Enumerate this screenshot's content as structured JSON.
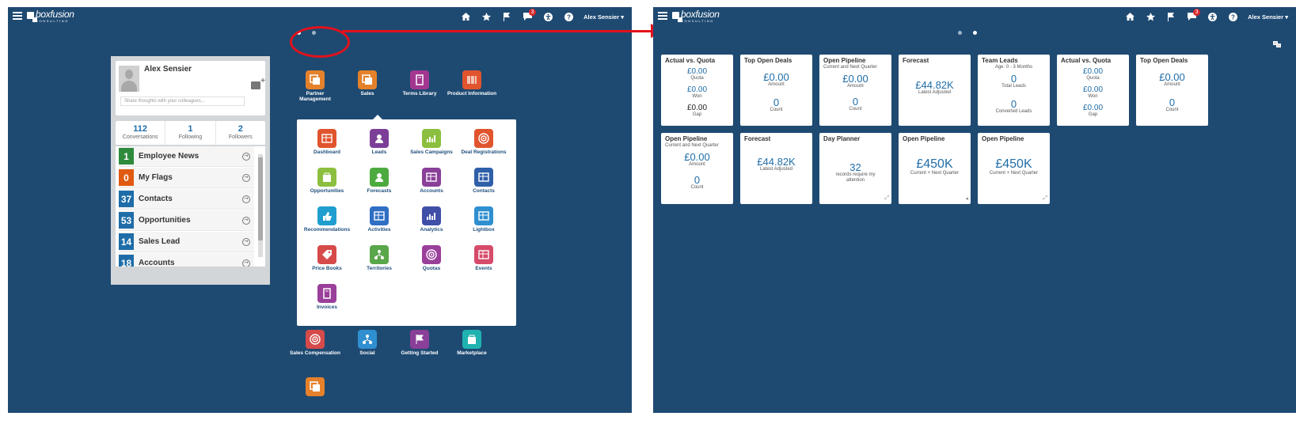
{
  "brand": {
    "name": "boxfusion",
    "sub": "CONSULTING"
  },
  "user": {
    "name": "Alex Sensier ▾"
  },
  "notifications": {
    "count": "3"
  },
  "icons": [
    "menu-icon",
    "home-icon",
    "star-icon",
    "flag-icon",
    "chat-icon",
    "accessibility-icon",
    "help-icon"
  ],
  "colors": {
    "background": "#1e4a72",
    "accent": "#1f6da8",
    "callout": "#e4111b"
  },
  "profile": {
    "name": "Alex Sensier",
    "share_placeholder": "Share thoughts with your colleagues...",
    "stats": [
      {
        "n": "112",
        "l": "Conversations"
      },
      {
        "n": "1",
        "l": "Following"
      },
      {
        "n": "2",
        "l": "Followers"
      }
    ],
    "items": [
      {
        "count": "1",
        "label": "Employee News",
        "color": "#2e8b3c"
      },
      {
        "count": "0",
        "label": "My Flags",
        "color": "#e05a12"
      },
      {
        "count": "37",
        "label": "Contacts",
        "color": "#1f6da8"
      },
      {
        "count": "53",
        "label": "Opportunities",
        "color": "#1f6da8"
      },
      {
        "count": "14",
        "label": "Sales Lead",
        "color": "#1f6da8"
      },
      {
        "count": "18",
        "label": "Accounts",
        "color": "#1f6da8"
      }
    ]
  },
  "apps_top": [
    "Partner Management",
    "Sales",
    "Terms Library",
    "Product Information"
  ],
  "drawer": [
    "Dashboard",
    "Leads",
    "Sales Campaigns",
    "Deal Registrations",
    "Opportunities",
    "Forecasts",
    "Accounts",
    "Contacts",
    "Recommendations",
    "Activities",
    "Analytics",
    "Lightbox",
    "Price Books",
    "Territories",
    "Quotas",
    "Events",
    "Invoices"
  ],
  "apps_bottom": [
    "Sales Compensation",
    "Social",
    "Getting Started",
    "Marketplace"
  ],
  "tiles": {
    "t1": {
      "h": "Actual vs. Quota",
      "v1": "£0.00",
      "l1": "Quota",
      "v2": "£0.00",
      "l2": "Won",
      "v3": "£0.00",
      "l3": "Gap"
    },
    "t2": {
      "h": "Top Open Deals",
      "v1": "£0.00",
      "l1": "Amount",
      "v2": "0",
      "l2": "Count"
    },
    "t3": {
      "h": "Open Pipeline",
      "s": "Current and Next Quarter",
      "v1": "£0.00",
      "l1": "Amount",
      "v2": "0",
      "l2": "Count"
    },
    "t4": {
      "h": "Forecast",
      "v1": "£44.82K",
      "l1": "Latest Adjusted"
    },
    "t5": {
      "h": "Team Leads",
      "s": "Age: 0 - 3 Months",
      "v1": "0",
      "l1": "Total Leads",
      "v2": "0",
      "l2": "Converted Leads"
    },
    "t6": {
      "h": "Actual vs. Quota",
      "v1": "£0.00",
      "l1": "Quota",
      "v2": "£0.00",
      "l2": "Won",
      "v3": "£0.00",
      "l3": "Gap"
    },
    "t7": {
      "h": "Top Open Deals",
      "v1": "£0.00",
      "l1": "Amount",
      "v2": "0",
      "l2": "Count"
    },
    "t8": {
      "h": "Open Pipeline",
      "s": "Current and Next Quarter",
      "v1": "£0.00",
      "l1": "Amount",
      "v2": "0",
      "l2": "Count"
    },
    "t9": {
      "h": "Forecast",
      "v1": "£44.82K",
      "l1": "Latest Adjusted"
    },
    "t10": {
      "h": "Day Planner",
      "v1": "32",
      "l1": "records require my attention"
    },
    "t11": {
      "h": "Open Pipeline",
      "v1": "£450K",
      "l1": "Current + Next Quarter"
    },
    "t12": {
      "h": "Open Pipeline",
      "v1": "£450K",
      "l1": "Current + Next Quarter"
    }
  }
}
